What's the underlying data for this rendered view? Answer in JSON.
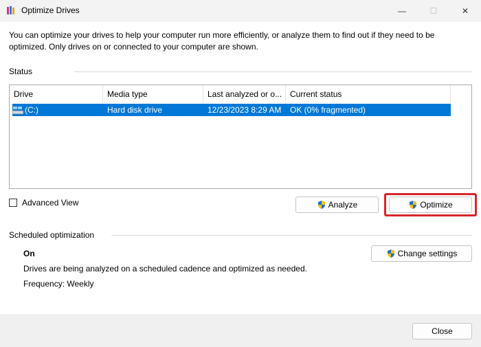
{
  "window": {
    "title": "Optimize Drives",
    "minimize_glyph": "—",
    "maximize_glyph": "☐",
    "close_glyph": "✕"
  },
  "intro_text": "You can optimize your drives to help your computer run more efficiently, or analyze them to find out if they need to be optimized. Only drives on or connected to your computer are shown.",
  "status": {
    "label": "Status",
    "columns": [
      "Drive",
      "Media type",
      "Last analyzed or o...",
      "Current status"
    ],
    "rows": [
      {
        "drive": "(C:)",
        "media_type": "Hard disk drive",
        "last_analyzed": "12/23/2023 8:29 AM",
        "current_status": "OK (0% fragmented)",
        "selected": true
      }
    ]
  },
  "advanced_view": {
    "label": "Advanced View",
    "checked": false
  },
  "buttons": {
    "analyze": "Analyze",
    "optimize": "Optimize",
    "change_settings": "Change settings",
    "close": "Close"
  },
  "scheduled": {
    "label": "Scheduled optimization",
    "state": "On",
    "description": "Drives are being analyzed on a scheduled cadence and optimized as needed.",
    "frequency": "Frequency: Weekly"
  },
  "colors": {
    "selection": "#0078d7",
    "highlight_border": "#d9252a",
    "shield_blue": "#1f6fd0",
    "shield_yellow": "#f5c400"
  },
  "icons": [
    "app-icon",
    "drive-icon",
    "shield-icon"
  ]
}
